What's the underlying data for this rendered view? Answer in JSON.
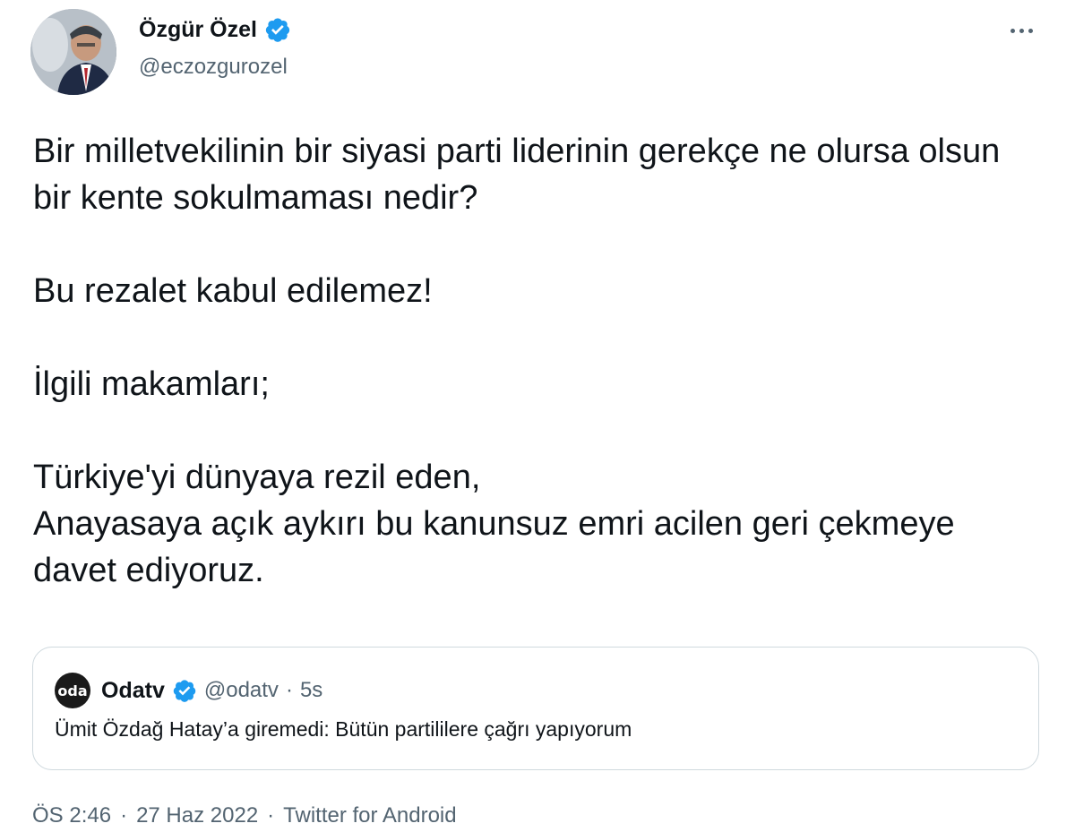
{
  "author": {
    "name": "Özgür Özel",
    "handle": "@eczozgurozel",
    "verified_color": "#1d9bf0"
  },
  "more_menu": {
    "icon": "more-horizontal-icon"
  },
  "tweet": {
    "paragraphs": [
      "Bir milletvekilinin bir siyasi parti liderinin gerekçe ne olursa olsun bir kente sokulmaması nedir?",
      "Bu rezalet kabul edilemez!",
      "İlgili makamları;",
      "Türkiye'yi dünyaya rezil eden,\nAnayasaya açık aykırı bu kanunsuz emri acilen geri çekmeye davet ediyoruz."
    ]
  },
  "quote": {
    "avatar_text": "oda",
    "name": "Odatv",
    "handle": "@odatv",
    "separator": "·",
    "time": "5s",
    "text": "Ümit Özdağ Hatay’a giremedi: Bütün partililere çağrı yapıyorum"
  },
  "footer": {
    "time": "ÖS 2:46",
    "sep1": "·",
    "date": "27 Haz 2022",
    "sep2": "·",
    "source": "Twitter for Android"
  },
  "colors": {
    "text": "#0f1419",
    "secondary": "#536471",
    "border": "#cfd9de",
    "verified": "#1d9bf0"
  }
}
